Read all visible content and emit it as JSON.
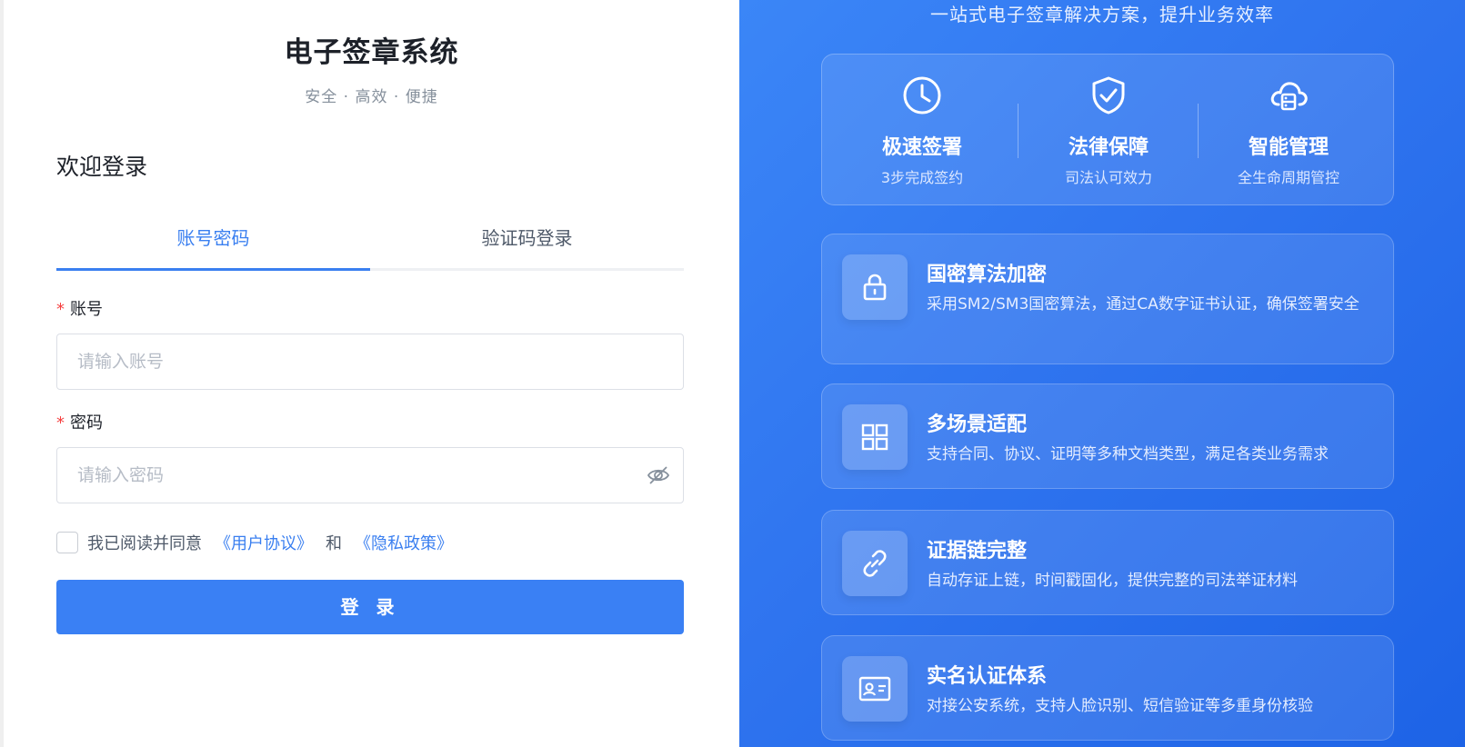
{
  "brand": {
    "title": "电子签章系统",
    "subtitle": "安全 · 高效 · 便捷"
  },
  "login": {
    "welcome": "欢迎登录",
    "tabs": [
      {
        "label": "账号密码",
        "active": true
      },
      {
        "label": "验证码登录",
        "active": false
      }
    ],
    "account": {
      "label": "账号",
      "placeholder": "请输入账号"
    },
    "password": {
      "label": "密码",
      "placeholder": "请输入密码"
    },
    "required_mark": "*",
    "agreement": {
      "prefix": "我已阅读并同意",
      "user_agreement": "《用户协议》",
      "conjunction": "和",
      "privacy_policy": "《隐私政策》",
      "checked": false
    },
    "submit_label": "登 录"
  },
  "promo": {
    "tagline": "一站式电子签章解决方案，提升业务效率",
    "stats": [
      {
        "title": "极速签署",
        "desc": "3步完成签约",
        "icon": "clock-icon"
      },
      {
        "title": "法律保障",
        "desc": "司法认可效力",
        "icon": "shield-check-icon"
      },
      {
        "title": "智能管理",
        "desc": "全生命周期管控",
        "icon": "cloud-server-icon"
      }
    ],
    "features": [
      {
        "title": "国密算法加密",
        "desc": "采用SM2/SM3国密算法，通过CA数字证书认证，确保签署安全",
        "icon": "lock-icon"
      },
      {
        "title": "多场景适配",
        "desc": "支持合同、协议、证明等多种文档类型，满足各类业务需求",
        "icon": "grid-icon"
      },
      {
        "title": "证据链完整",
        "desc": "自动存证上链，时间戳固化，提供完整的司法举证材料",
        "icon": "link-icon"
      },
      {
        "title": "实名认证体系",
        "desc": "对接公安系统，支持人脸识别、短信验证等多重身份核验",
        "icon": "id-card-icon"
      }
    ]
  },
  "colors": {
    "accent": "#3a7ff0",
    "required": "#f53f3f",
    "panel_gradient_start": "#3b86f7",
    "panel_gradient_end": "#1d63e6"
  }
}
